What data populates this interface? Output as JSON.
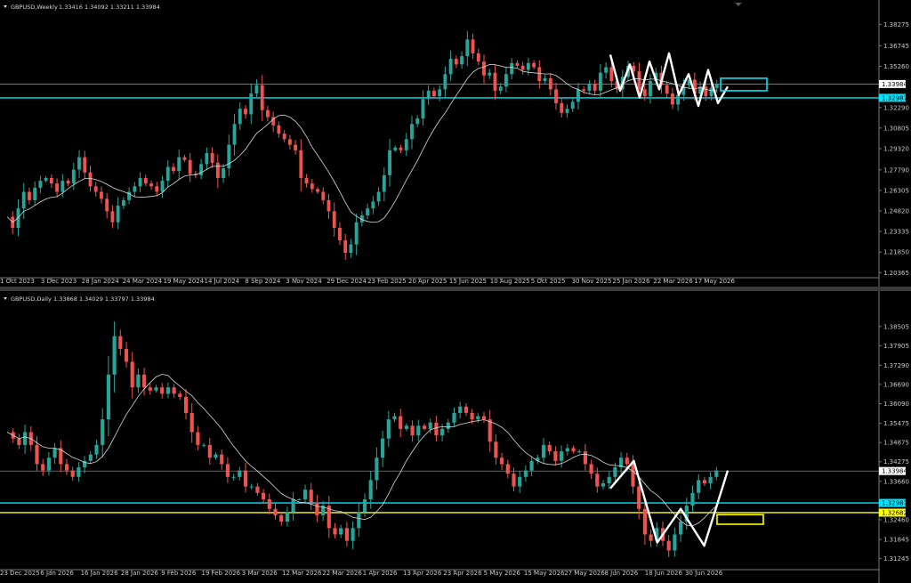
{
  "colors": {
    "background": "#000000",
    "bull": "#26a69a",
    "bear": "#ef5350",
    "ma": "#d8d8d8",
    "cyan": "#00e5ff",
    "yellow": "#ffff00",
    "axis": "#7a7a7a",
    "price_line": "#9a9a9a"
  },
  "chart_data": [
    {
      "type": "candlestick",
      "symbol": "GBPUSD,Weekly",
      "ohlc_text": "1.33416 1.34092 1.33211 1.33984",
      "ylim": [
        1.2,
        1.3915
      ],
      "yticks": [
        "1.38275",
        "1.36745",
        "1.35260",
        "1.33984",
        "1.32987",
        "1.32290",
        "1.30805",
        "1.29320",
        "1.27790",
        "1.26305",
        "1.24820",
        "1.23335",
        "1.21850",
        "1.20365"
      ],
      "xticks": [
        "1 Oct 2023",
        "3 Dec 2023",
        "28 Jan 2024",
        "24 Mar 2024",
        "19 May 2024",
        "14 Jul 2024",
        "8 Sep 2024",
        "3 Nov 2024",
        "29 Dec 2024",
        "23 Feb 2025",
        "20 Apr 2025",
        "15 Jun 2025",
        "10 Aug 2025",
        "5 Oct 2025",
        "30 Nov 2025",
        "25 Jan 2026",
        "22 Mar 2026",
        "17 May 2026"
      ],
      "current_price": 1.33984,
      "current_price_label": "1.33984",
      "levels": [
        {
          "price": 1.32987,
          "label": "1.32987",
          "color": "#00e5ff"
        }
      ],
      "path": [
        1.244,
        1.236,
        1.25,
        1.262,
        1.256,
        1.265,
        1.27,
        1.272,
        1.268,
        1.262,
        1.27,
        1.268,
        1.278,
        1.287,
        1.276,
        1.266,
        1.262,
        1.257,
        1.248,
        1.24,
        1.252,
        1.256,
        1.262,
        1.266,
        1.272,
        1.268,
        1.266,
        1.262,
        1.27,
        1.28,
        1.277,
        1.287,
        1.285,
        1.275,
        1.274,
        1.282,
        1.29,
        1.283,
        1.272,
        1.279,
        1.296,
        1.311,
        1.322,
        1.318,
        1.333,
        1.339,
        1.321,
        1.316,
        1.31,
        1.304,
        1.3,
        1.296,
        1.292,
        1.272,
        1.268,
        1.264,
        1.262,
        1.256,
        1.248,
        1.236,
        1.227,
        1.218,
        1.224,
        1.24,
        1.245,
        1.25,
        1.255,
        1.262,
        1.274,
        1.292,
        1.294,
        1.292,
        1.3,
        1.311,
        1.315,
        1.329,
        1.335,
        1.331,
        1.336,
        1.347,
        1.358,
        1.354,
        1.36,
        1.372,
        1.362,
        1.356,
        1.346,
        1.348,
        1.335,
        1.338,
        1.347,
        1.355,
        1.353,
        1.35,
        1.355,
        1.352,
        1.342,
        1.344,
        1.336,
        1.326,
        1.319,
        1.322,
        1.327,
        1.336,
        1.335,
        1.34,
        1.335,
        1.348,
        1.352,
        1.342,
        1.336,
        1.345,
        1.353,
        1.349,
        1.336,
        1.331,
        1.342,
        1.348,
        1.339,
        1.333,
        1.325,
        1.332,
        1.339,
        1.343,
        1.333,
        1.338,
        1.331,
        1.337,
        1.34
      ],
      "zigzag": [
        1.361,
        1.335,
        1.354,
        1.33,
        1.356,
        1.336,
        1.362,
        1.332,
        1.347,
        1.324,
        1.35,
        1.326,
        1.338
      ],
      "box": {
        "color": "#00e5ff",
        "price_top": 1.344,
        "price_bottom": 1.335
      }
    },
    {
      "type": "candlestick",
      "symbol": "GBPUSD,Daily",
      "ohlc_text": "1.33868 1.34029 1.33797 1.33984",
      "ylim": [
        1.309,
        1.3925
      ],
      "yticks": [
        "1.38505",
        "1.37905",
        "1.37290",
        "1.36690",
        "1.36090",
        "1.35475",
        "1.34875",
        "1.34275",
        "1.33984",
        "1.33660",
        "1.32987",
        "1.32682",
        "1.32460",
        "1.31845",
        "1.31245"
      ],
      "xticks": [
        "23 Dec 2025",
        "6 Jan 2026",
        "16 Jan 2026",
        "28 Jan 2026",
        "9 Feb 2026",
        "19 Feb 2026",
        "3 Mar 2026",
        "12 Mar 2026",
        "22 Mar 2026",
        "1 Apr 2026",
        "13 Apr 2026",
        "23 Apr 2026",
        "5 May 2026",
        "15 May 2026",
        "27 May 2026",
        "8 Jun 2026",
        "18 Jun 2026",
        "30 Jun 2026"
      ],
      "current_price": 1.33984,
      "current_price_label": "1.33984",
      "levels": [
        {
          "price": 1.32987,
          "label": "1.32987",
          "color": "#00e5ff"
        },
        {
          "price": 1.32682,
          "label": "1.32682",
          "color": "#ffff00"
        }
      ],
      "path": [
        1.352,
        1.35,
        1.348,
        1.352,
        1.348,
        1.342,
        1.34,
        1.344,
        1.347,
        1.342,
        1.34,
        1.338,
        1.341,
        1.343,
        1.345,
        1.348,
        1.356,
        1.37,
        1.382,
        1.378,
        1.374,
        1.366,
        1.37,
        1.366,
        1.365,
        1.366,
        1.364,
        1.366,
        1.364,
        1.363,
        1.358,
        1.352,
        1.348,
        1.348,
        1.344,
        1.345,
        1.342,
        1.338,
        1.338,
        1.34,
        1.335,
        1.335,
        1.333,
        1.331,
        1.328,
        1.326,
        1.324,
        1.327,
        1.331,
        1.331,
        1.334,
        1.33,
        1.326,
        1.329,
        1.322,
        1.32,
        1.322,
        1.318,
        1.322,
        1.327,
        1.331,
        1.337,
        1.344,
        1.35,
        1.356,
        1.357,
        1.353,
        1.354,
        1.351,
        1.354,
        1.353,
        1.355,
        1.351,
        1.353,
        1.355,
        1.358,
        1.36,
        1.358,
        1.356,
        1.357,
        1.356,
        1.349,
        1.344,
        1.342,
        1.339,
        1.335,
        1.338,
        1.34,
        1.343,
        1.344,
        1.348,
        1.346,
        1.343,
        1.346,
        1.347,
        1.346,
        1.346,
        1.342,
        1.339,
        1.335,
        1.336,
        1.338,
        1.341,
        1.344,
        1.342,
        1.335,
        1.328,
        1.32,
        1.318,
        1.322,
        1.318,
        1.315,
        1.32,
        1.324,
        1.329,
        1.333,
        1.337,
        1.336,
        1.338,
        1.34
      ],
      "zigzag": [
        1.3344,
        1.343,
        1.3175,
        1.328,
        1.3165,
        1.34
      ],
      "box": {
        "color": "#ffff00",
        "price_top": 1.3262,
        "price_bottom": 1.3232
      }
    }
  ]
}
